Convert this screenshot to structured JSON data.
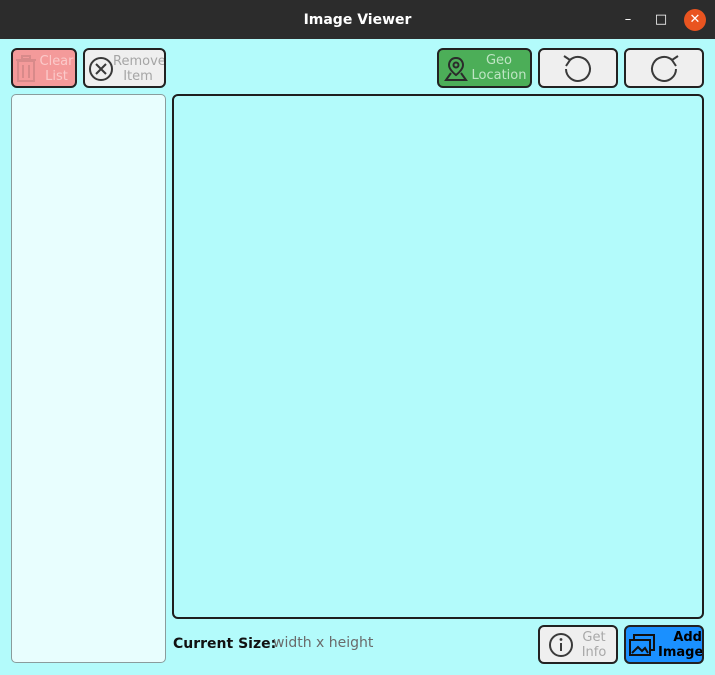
{
  "window": {
    "title": "Image Viewer",
    "minimize_symbol": "–",
    "maximize_symbol": "□",
    "close_symbol": "✕"
  },
  "toolbar": {
    "clear_list": {
      "line1": "Clear",
      "line2": "List",
      "icon": "trash-icon",
      "enabled": false,
      "color": "#f49a9a"
    },
    "remove_item": {
      "line1": "Remove",
      "line2": "Item",
      "icon": "circle-x-icon",
      "enabled": false
    },
    "geo_location": {
      "line1": "Geo",
      "line2": "Location",
      "icon": "map-pin-icon",
      "enabled": false,
      "color": "#4cae58"
    },
    "rotate_left": {
      "icon": "rotate-ccw-icon"
    },
    "rotate_right": {
      "icon": "rotate-cw-icon"
    }
  },
  "image_list": {
    "items": []
  },
  "footer": {
    "current_size_label": "Current Size:",
    "current_size_value": "width x height",
    "get_info": {
      "line1": "Get",
      "line2": "Info",
      "icon": "info-icon",
      "enabled": false
    },
    "add_image": {
      "line1": "Add",
      "line2": "Image",
      "icon": "image-add-icon",
      "color": "#1a90ff"
    }
  },
  "colors": {
    "background": "#b3fbfb",
    "list_background": "#e8fefe",
    "titlebar": "#2c2c2c",
    "close_button": "#e95420"
  }
}
